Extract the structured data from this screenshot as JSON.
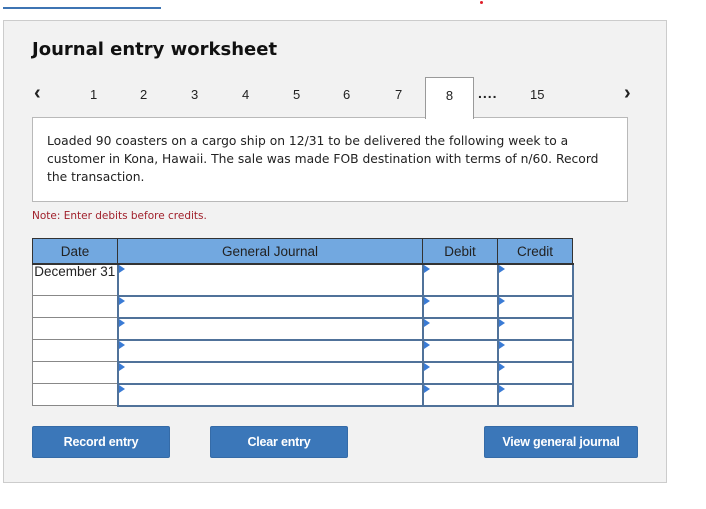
{
  "header": {
    "title": "Journal entry worksheet"
  },
  "pager": {
    "prev_icon": "chevron-left-icon",
    "next_icon": "chevron-right-icon",
    "prev_glyph": "‹",
    "next_glyph": "›",
    "pages": [
      "1",
      "2",
      "3",
      "4",
      "5",
      "6",
      "7"
    ],
    "active": "8",
    "ellipsis": "....",
    "last": "15"
  },
  "description": "Loaded 90 coasters on a cargo ship on 12/31 to be delivered the following week to a customer in Kona, Hawaii. The sale was made FOB destination with terms of n/60. Record the transaction.",
  "note": "Note: Enter debits before credits.",
  "table": {
    "headers": {
      "date": "Date",
      "journal": "General Journal",
      "debit": "Debit",
      "credit": "Credit"
    },
    "rows": [
      {
        "date": "December 31",
        "account": "",
        "debit": "",
        "credit": ""
      },
      {
        "date": "",
        "account": "",
        "debit": "",
        "credit": ""
      },
      {
        "date": "",
        "account": "",
        "debit": "",
        "credit": ""
      },
      {
        "date": "",
        "account": "",
        "debit": "",
        "credit": ""
      },
      {
        "date": "",
        "account": "",
        "debit": "",
        "credit": ""
      },
      {
        "date": "",
        "account": "",
        "debit": "",
        "credit": ""
      }
    ]
  },
  "buttons": {
    "record": "Record entry",
    "clear": "Clear entry",
    "view": "View general journal"
  },
  "colors": {
    "accent": "#3b77b9",
    "header_bg": "#72a8e0",
    "note": "#a01f2a"
  }
}
